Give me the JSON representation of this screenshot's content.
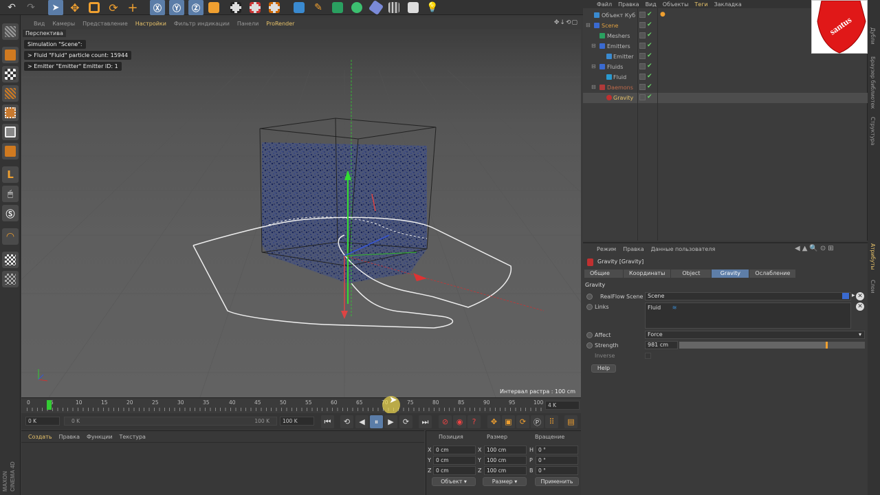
{
  "viewport": {
    "menu": [
      "Вид",
      "Камеры",
      "Представление",
      "Настройки",
      "Фильтр индикации",
      "Панели",
      "ProRender"
    ],
    "label": "Перспектива",
    "hud": [
      "Simulation \"Scene\":",
      "> Fluid \"Fluid\" particle count: 15944",
      "> Emitter \"Emitter\" Emitter ID: 1"
    ],
    "raster": "Интервал растра : 100 cm"
  },
  "timeline": {
    "ticks": [
      "0",
      "5",
      "10",
      "15",
      "20",
      "25",
      "30",
      "35",
      "40",
      "45",
      "50",
      "55",
      "60",
      "65",
      "70",
      "75",
      "80",
      "85",
      "90",
      "95",
      "100"
    ],
    "current_frame_marker": "4 K",
    "field_left": "0 K",
    "slider_left": "0 K",
    "slider_right": "100 K",
    "field_right": "100 K"
  },
  "material": {
    "menu": [
      "Создать",
      "Правка",
      "Функции",
      "Текстура"
    ]
  },
  "coords": {
    "headers": [
      "Позиция",
      "Размер",
      "Вращение"
    ],
    "rows": [
      {
        "a": "X",
        "pos": "0 cm",
        "b": "X",
        "size": "100 cm",
        "c": "H",
        "rot": "0 °"
      },
      {
        "a": "Y",
        "pos": "0 cm",
        "b": "Y",
        "size": "100 cm",
        "c": "P",
        "rot": "0 °"
      },
      {
        "a": "Z",
        "pos": "0 cm",
        "b": "Z",
        "size": "100 cm",
        "c": "B",
        "rot": "0 °"
      }
    ],
    "mode1": "Объект",
    "mode2": "Размер",
    "apply": "Применить"
  },
  "objects": {
    "menu": [
      "Файл",
      "Правка",
      "Вид",
      "Объекты",
      "Теги",
      "Закладка"
    ],
    "items": [
      {
        "name": "Объект Куб",
        "color": "#bbbbbb"
      },
      {
        "name": "Scene",
        "color": "#e0a040"
      },
      {
        "name": "Meshers",
        "color": "#bbbbbb"
      },
      {
        "name": "Emitters",
        "color": "#bbbbbb"
      },
      {
        "name": "Emitter",
        "color": "#bbbbbb"
      },
      {
        "name": "Fluids",
        "color": "#bbbbbb"
      },
      {
        "name": "Fluid",
        "color": "#bbbbbb"
      },
      {
        "name": "Daemons",
        "color": "#c06a4a"
      },
      {
        "name": "Gravity",
        "color": "#e8c36a"
      }
    ]
  },
  "logo_text": "santus",
  "side_tabs": [
    "Дубли",
    "Браузер библиотек",
    "Структура"
  ],
  "side_tabs_bottom": [
    "Атрибуты",
    "Слои"
  ],
  "attributes": {
    "menu": [
      "Режим",
      "Правка",
      "Данные пользователя"
    ],
    "title": "Gravity [Gravity]",
    "tabs": [
      "Общие",
      "Координаты",
      "Object",
      "Gravity",
      "Ослабление"
    ],
    "group": "Gravity",
    "realflow_label": "RealFlow Scene",
    "realflow_value": "Scene",
    "links_label": "Links",
    "links_value": "Fluid",
    "affect_label": "Affect",
    "affect_value": "Force",
    "strength_label": "Strength",
    "strength_value": "981 cm",
    "strength_level": 0.8,
    "inverse_label": "Inverse",
    "help": "Help"
  }
}
